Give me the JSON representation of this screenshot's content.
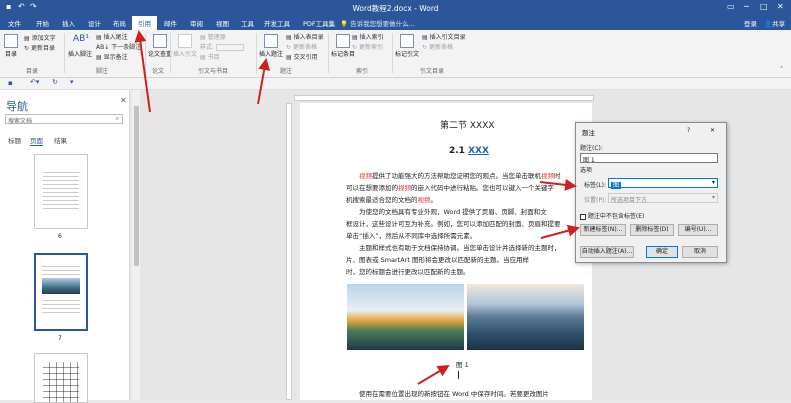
{
  "window": {
    "title": "Word教程2.docx - Word",
    "user": "登录",
    "share": "共享"
  },
  "tabs": [
    "文件",
    "开始",
    "插入",
    "设计",
    "布局",
    "引用",
    "邮件",
    "审阅",
    "视图",
    "工具",
    "开发工具",
    "PDF工具集"
  ],
  "active_tab": "引用",
  "tellme": "告诉我您想要做什么...",
  "ribbon": {
    "toc": {
      "big": "目录",
      "add_text": "添加文字",
      "update": "更新目录",
      "group": "目录"
    },
    "footnote": {
      "insert_footnote": "插入脚注",
      "insert_endnote": "插入尾注",
      "next": "下一条脚注",
      "show": "显示备注",
      "group": "脚注"
    },
    "research": {
      "label": "论文查重",
      "group": "论文"
    },
    "citation": {
      "insert": "插入引文",
      "manage": "管理源",
      "style": "样式:",
      "biblio": "书目",
      "group": "引文与书目"
    },
    "caption": {
      "insert": "插入题注",
      "table_fig": "插入表目录",
      "update": "更新表格",
      "cross": "交叉引用",
      "group": "题注"
    },
    "index": {
      "mark": "标记条目",
      "insert": "插入索引",
      "update": "更新索引",
      "group": "索引"
    },
    "authority": {
      "mark": "标记引文",
      "insert": "插入引文目录",
      "update": "更新表格",
      "group": "引文目录"
    }
  },
  "nav": {
    "title": "导航",
    "search_placeholder": "搜索文档",
    "tabs": [
      "标题",
      "页面",
      "结果"
    ],
    "active": "页面",
    "page_numbers": [
      "6",
      "7"
    ]
  },
  "doc": {
    "heading": "第二节 XXXX",
    "subheading_num": "2.1",
    "subheading": "XXX",
    "p1_red": "视频",
    "p1": "提供了功能强大的方法帮助您证明您的观点。当您单击联机",
    "p1_red2": "视频",
    "p1_cont": "时",
    "p1b": "可以在想要添加的",
    "p1b_red": "视频",
    "p1b_cont": "的嵌入代码中进行粘贴。您也可以键入一个关键字",
    "p1c": "机搜索最适合您的文档的",
    "p1c_red": "视频",
    "p1c_end": "。",
    "p2": "为使您的文档具有专业外观，Word 提供了页眉、页脚、封面和文",
    "p2b": "框设计，这些设计可互为补充。例如，您可以添加匹配的封面、页眉和提要",
    "p2c": "单击“插入”，然后从不同库中选择所需元素。",
    "p3": "主题和样式也有助于文档保持协调。当您单击设计并选择新的主题时，",
    "p3b": "片、图表或 SmartArt 图形将会更改以匹配新的主题。当应用样",
    "p3c": "时，您的标题会进行更改以匹配新的主题。",
    "caption": "图 1",
    "p4": "使用在需要位置出现的新按钮在 Word 中保存时间。若要更改图片"
  },
  "dialog": {
    "title": "题注",
    "help": "?",
    "close": "✕",
    "caption_label": "题注(C):",
    "caption_value": "图 1",
    "options": "选项",
    "label_label": "标签(L):",
    "label_value": "图",
    "position_label": "位置(P):",
    "position_value": "所选项目下方",
    "exclude": "题注中不包含标签(E)",
    "new_label": "新建标签(N)...",
    "delete_label": "删除标签(D)",
    "numbering": "编号(U)...",
    "auto": "自动插入题注(A)...",
    "ok": "确定",
    "cancel": "取消"
  },
  "accent": "#2b579a",
  "arrow_color": "#d0201f"
}
